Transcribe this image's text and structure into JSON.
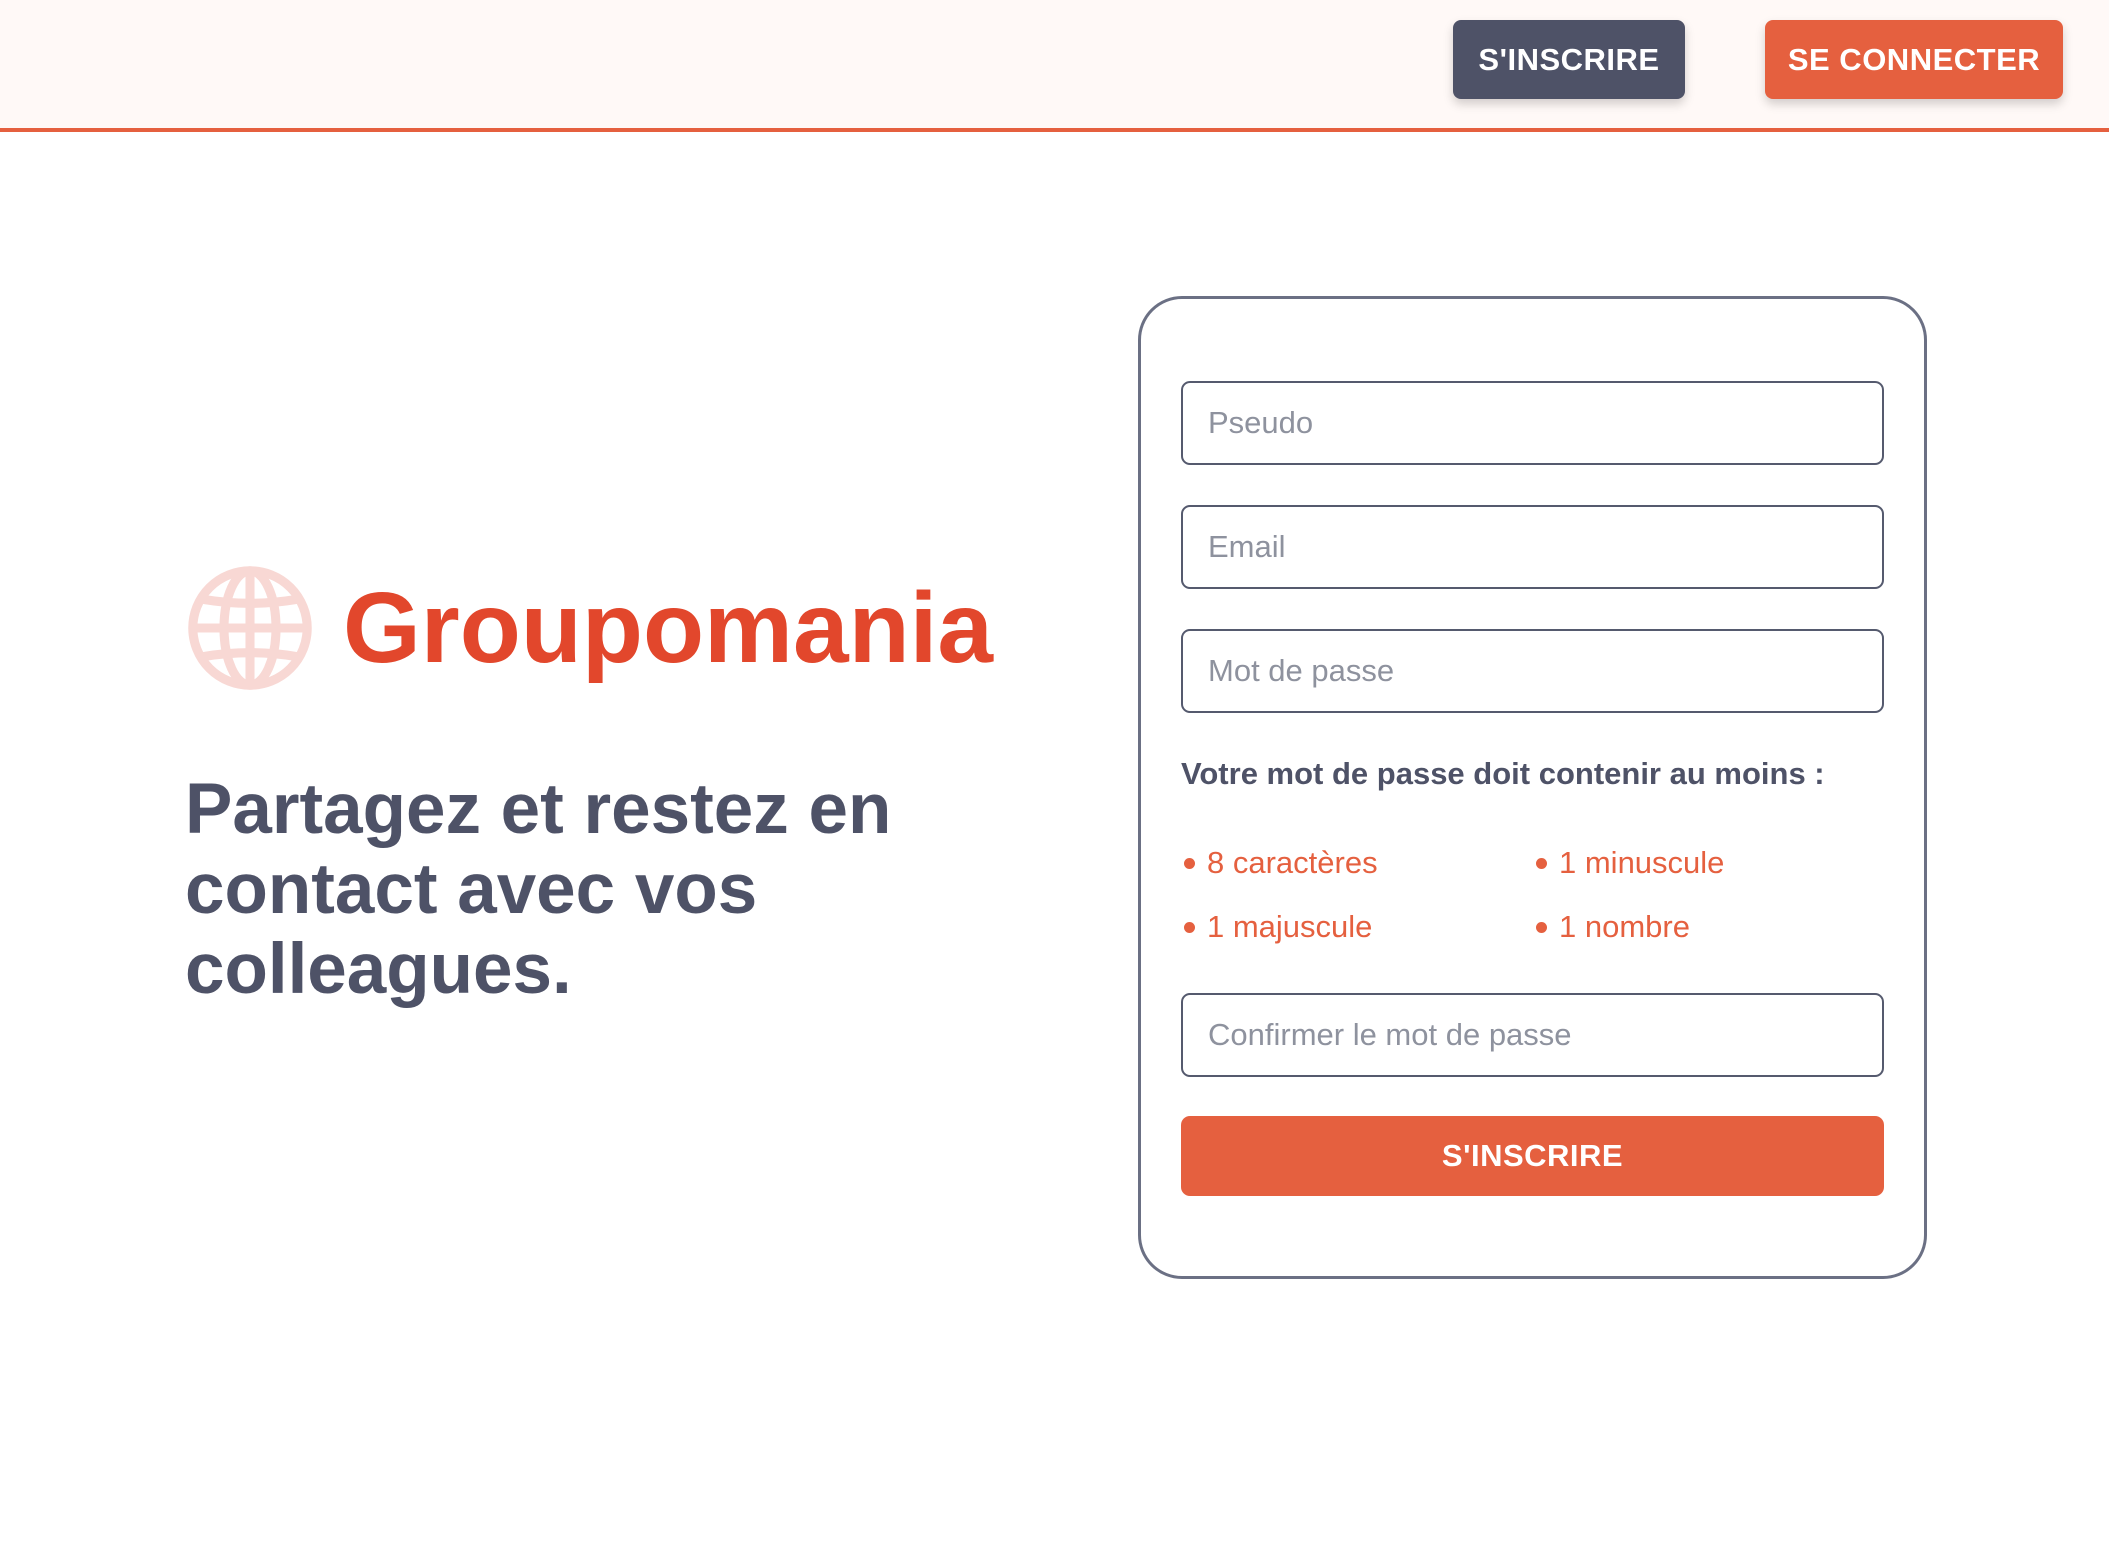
{
  "header": {
    "signup_label": "S'INSCRIRE",
    "login_label": "SE CONNECTER"
  },
  "brand": {
    "name": "Groupomania",
    "icon": "globe-icon"
  },
  "tagline": "Partagez et restez en contact avec vos colleagues.",
  "form": {
    "pseudo_placeholder": "Pseudo",
    "email_placeholder": "Email",
    "password_placeholder": "Mot de passe",
    "password_hint": "Votre mot de passe doit contenir au moins :",
    "requirements": [
      "8 caractères",
      "1 minuscule",
      "1 majuscule",
      "1 nombre"
    ],
    "confirm_placeholder": "Confirmer le mot de passe",
    "submit_label": "S'INSCRIRE"
  },
  "colors": {
    "accent": "#e5603f",
    "brand": "#e2472c",
    "dark": "#4e5267",
    "header_bg": "#fff9f7"
  }
}
